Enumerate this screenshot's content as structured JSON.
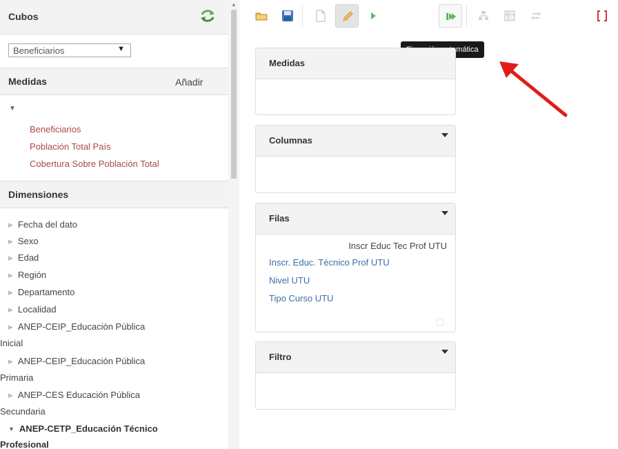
{
  "sidebar": {
    "cubes_title": "Cubos",
    "cube_select": "Beneficiarios",
    "measures_title": "Medidas",
    "add_label": "Añadir",
    "measures": [
      "Beneficiarios",
      "Población Total País",
      "Cobertura Sobre Población Total"
    ],
    "dimensions_title": "Dimensiones",
    "dimensions": {
      "d1": "Fecha del dato",
      "d2": "Sexo",
      "d3": "Edad",
      "d4": "Región",
      "d5": "Departamento",
      "d6": "Localidad",
      "d7a": "ANEP-CEIP_Educación Pública",
      "d7b": "Inicial",
      "d8a": "ANEP-CEIP_Educación Pública",
      "d8b": "Primaria",
      "d9a": "ANEP-CES Educación Pública",
      "d9b": "Secundaria",
      "d10a": "ANEP-CETP_Educación Técnico",
      "d10b": "Profesional"
    }
  },
  "toolbar": {
    "tooltip": "Ejecución automática",
    "icons": [
      "folder-icon",
      "save-icon",
      "new-document-icon",
      "pencil-icon",
      "play-icon",
      "auto-run-icon",
      "hierarchy-icon",
      "grid-icon",
      "swap-icon",
      "json-icon"
    ]
  },
  "panels": {
    "medidas": "Medidas",
    "columnas": "Columnas",
    "filas": "Filas",
    "filas_column": "Inscr Educ Tec Prof UTU",
    "filas_items": [
      "Inscr. Educ. Técnico Prof UTU",
      "Nivel UTU",
      "Tipo Curso UTU"
    ],
    "filtro": "Filtro"
  },
  "colors": {
    "measure_link": "#a84a4a",
    "field_link": "#3a6ea8",
    "annotation_arrow": "#e21b1b"
  }
}
